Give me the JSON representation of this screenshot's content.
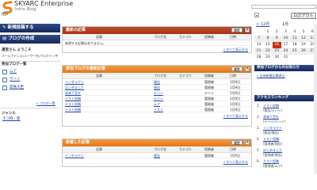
{
  "app": {
    "brand": "SKYARC Enterprise",
    "subbrand": "Intra Blog",
    "breadcrumb": "TOP"
  },
  "header": {
    "login_button": "ログアウト",
    "dropdown_icon": "chevron-down-icon"
  },
  "sidebar": {
    "nav": [
      "新規投稿する",
      "ブログの作成"
    ],
    "welcome_title": "運営さん ようこそ",
    "welcome_sub": "メールアドレス(ユーザー名)でログイン中",
    "myblogs_title": "参加ブログ一覧",
    "blogs": [
      "ムア",
      "テハイ",
      "新株大臣"
    ],
    "blog_more": "» ブログ一覧",
    "genre_title": "ジャンル",
    "genre_link": "ネコ特・夏"
  },
  "panels": [
    {
      "title": "最新の記事",
      "settings": "設定",
      "close": "×",
      "columns": [
        "記事",
        "ブログ名",
        "カテゴリ",
        "投稿者",
        "日時"
      ],
      "rows": [
        {
          "a": "新規する記事はありません。",
          "b": "",
          "c": "",
          "d": "",
          "e": ""
        }
      ],
      "more": "» すべて表示する"
    },
    {
      "title": "参加ブログの最新記事",
      "settings": "設定",
      "close": "×",
      "columns": [
        "記事",
        "ブログ名",
        "カテゴリ",
        "投稿者",
        "日時"
      ],
      "rows": [
        {
          "a": "インタラクト",
          "b": "報告",
          "c": "",
          "d": "管理者",
          "e": "1月9日"
        },
        {
          "a": "はじめました",
          "b": "報告",
          "c": "",
          "d": "管理者",
          "e": "1月9日"
        },
        {
          "a": "長来下宮を",
          "b": "テハイ",
          "c": "",
          "d": "テハイ",
          "e": "1月9日"
        },
        {
          "a": "テスト投稿",
          "b": "テハイ",
          "c": "",
          "d": "管理者",
          "e": "1月9日"
        },
        {
          "a": "テスト投稿",
          "b": "ムア",
          "c": "",
          "d": "管理者",
          "e": "1月9日"
        },
        {
          "a": "テスト投稿",
          "b": "テスト",
          "c": "",
          "d": "管理者",
          "e": "1月9日"
        }
      ],
      "more": "» すべて表示する"
    },
    {
      "title": "新着した記事",
      "settings": "設定",
      "close": "×",
      "columns": [
        "記事",
        "ブログ名",
        "カテゴリ",
        "投稿者",
        "日時"
      ],
      "rows": [
        {
          "a": "インタラクト",
          "b": "報告",
          "c": "",
          "d": "管理者",
          "e": "1月9日"
        }
      ],
      "more": "» すべて表示する"
    }
  ],
  "calendar": {
    "prev": "< 12月",
    "month": "1月",
    "rows": [
      [
        "",
        "1",
        "2",
        "3",
        "4",
        "5",
        "6"
      ],
      [
        "7",
        "8",
        "9",
        "10",
        "11",
        "12",
        "13"
      ],
      [
        "14",
        "15",
        "16",
        "17",
        "18",
        "19",
        "20"
      ],
      [
        "21",
        "22",
        "23",
        "24",
        "25",
        "26",
        "27"
      ],
      [
        "28",
        "29",
        "30",
        "31",
        "",
        "",
        ""
      ]
    ],
    "highlight": "16"
  },
  "news": {
    "title": "参加ブログからのお知らせ",
    "link": "» 全体新着記事表示"
  },
  "ranking": {
    "title": "アクセスランキング",
    "items": [
      {
        "n": "1.",
        "t": "テスト投稿",
        "s": "(報告/テハイ)"
      },
      {
        "n": "2.",
        "t": "長来下宮を",
        "s": "(テハイ/テハイ)"
      },
      {
        "n": "3.",
        "t": "インタラクト",
        "s": "(報告/報告)"
      },
      {
        "n": "4.",
        "t": "テスト投稿",
        "s": "(管理者/報告)"
      },
      {
        "n": "5.",
        "t": "はじめました",
        "s": "(管理者/報告)"
      },
      {
        "n": "6.",
        "t": "テスト投稿",
        "s": "(管理者/ムア)"
      }
    ]
  }
}
